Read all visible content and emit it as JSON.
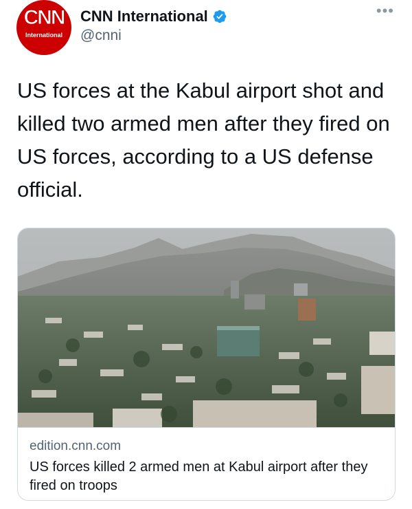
{
  "tweet": {
    "author": {
      "display_name": "CNN International",
      "handle": "@cnni",
      "avatar_logo_text": "CNN",
      "avatar_logo_subtext": "International",
      "verified": true,
      "brand_color": "#cc0000",
      "verified_color": "#1d9bf0"
    },
    "more_icon": "more-horizontal-icon",
    "more_glyph": "•••",
    "text": "US forces at the Kabul airport shot and killed two armed men after they fired on US forces, according to a US defense official."
  },
  "link_card": {
    "domain": "edition.cnn.com",
    "title": "US forces killed 2 armed men at Kabul airport after they fired on troops"
  }
}
